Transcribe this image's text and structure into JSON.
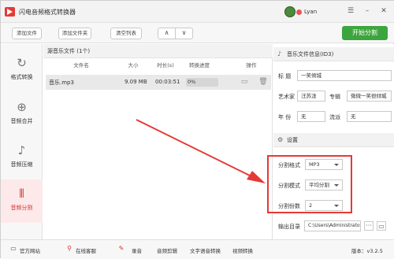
{
  "app": {
    "title": "闪电音频格式转换器",
    "user": "Lyan"
  },
  "toolbar": {
    "add_file": "添加文件",
    "add_folder": "添加文件夹",
    "clear_list": "清空列表",
    "up": "∧",
    "down": "∨",
    "start_split": "开始分割"
  },
  "sidebar": {
    "items": [
      {
        "label": "格式转换"
      },
      {
        "label": "音频合并"
      },
      {
        "label": "音频压缩"
      },
      {
        "label": "音频分割"
      }
    ]
  },
  "filelist": {
    "header": "源音乐文件 (1个)",
    "columns": [
      "文件名",
      "大小",
      "时长(s)",
      "转换进度",
      "操作"
    ],
    "rows": [
      {
        "name": "音乐.mp3",
        "size": "9.09 MB",
        "duration": "00:03:51",
        "progress": "0%"
      }
    ]
  },
  "info": {
    "header": "音乐文件信息(ID3)",
    "title_label": "标  题",
    "title_value": "一笑倾城",
    "artist_label": "艺术家",
    "artist_value": "汪苏泷",
    "album_label": "专辑",
    "album_value": "微微一笑很倾城",
    "year_label": "年  份",
    "year_value": "无",
    "genre_label": "流派",
    "genre_value": "无"
  },
  "settings": {
    "header": "设置",
    "format_label": "分割格式",
    "format_value": "MP3",
    "mode_label": "分割模式",
    "mode_value": "平均分割",
    "count_label": "分割份数",
    "count_value": "2",
    "output_label": "输出目录",
    "output_value": "C:\\Users\\Administrator",
    "more": "···"
  },
  "footer": {
    "site": "官方网站",
    "service": "在线客服",
    "record": "录音",
    "cut": "音频剪辑",
    "tts": "文字语音转换",
    "video": "视频转换",
    "version": "版本：v3.2.5"
  }
}
